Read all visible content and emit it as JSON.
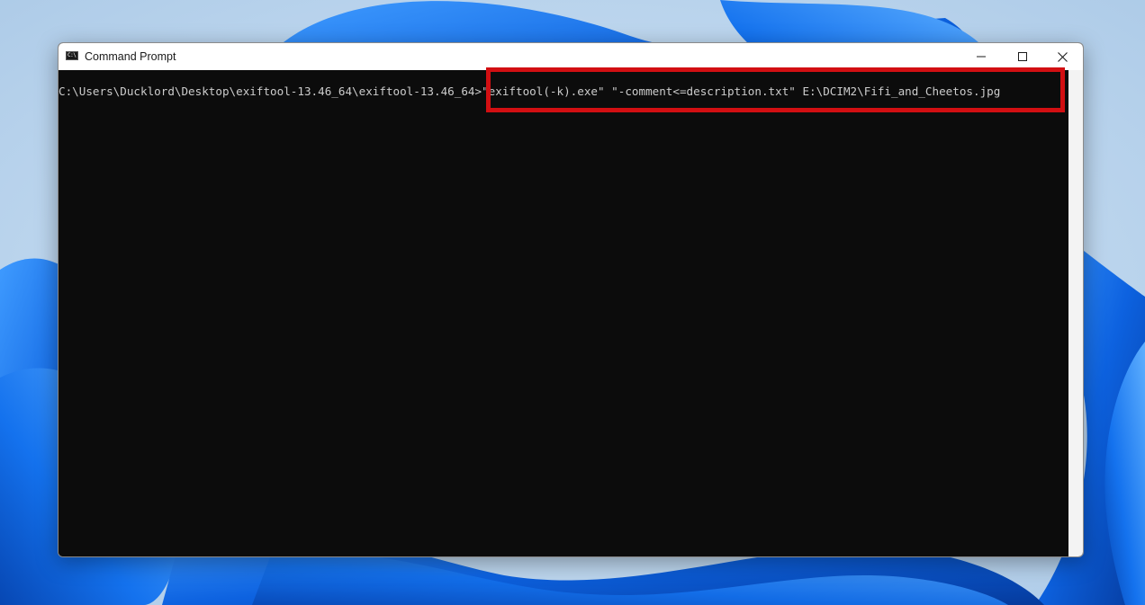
{
  "window": {
    "title": "Command Prompt",
    "icon": "cmd-icon",
    "controls": {
      "minimize": "minimize-icon",
      "maximize": "maximize-icon",
      "close": "close-icon"
    }
  },
  "console": {
    "prompt": "C:\\Users\\Ducklord\\Desktop\\exiftool-13.46_64\\exiftool-13.46_64>",
    "command": "\"exiftool(-k).exe\" \"-comment<=description.txt\" E:\\DCIM2\\Fifi_and_Cheetos.jpg",
    "background": "#0c0c0c",
    "text_color": "#cccccc"
  },
  "annotation": {
    "type": "highlight-box",
    "color": "#d20f12"
  },
  "wallpaper": {
    "description_colors": [
      "#0a5cd6",
      "#1a7af0",
      "#b9d3ea"
    ]
  }
}
